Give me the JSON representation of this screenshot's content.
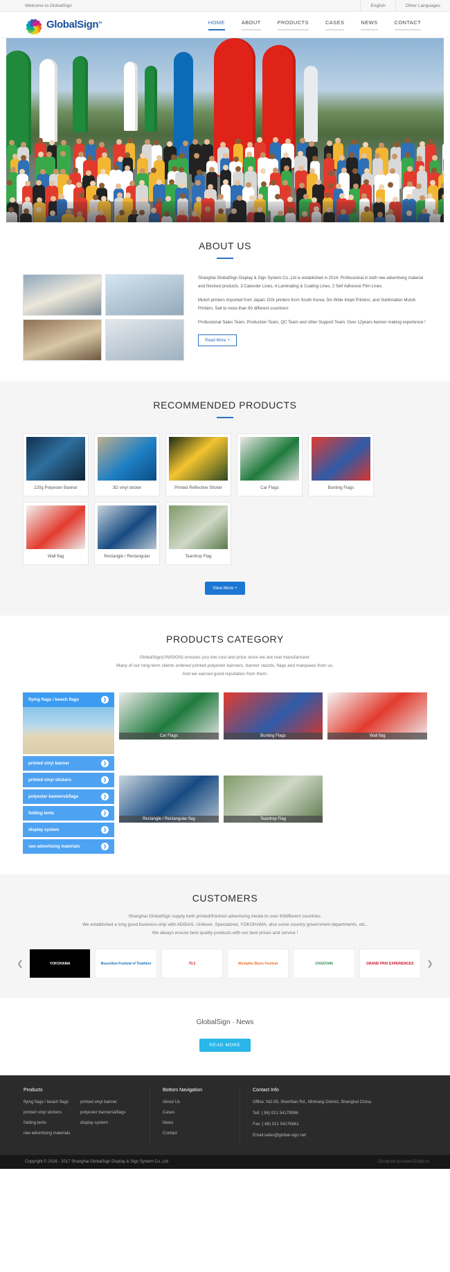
{
  "topbar": {
    "welcome": "Welcome to GlobalSign",
    "lang_primary": "English",
    "lang_other": "Other Languages"
  },
  "header": {
    "brand": "GlobalSign",
    "brand_tm": "тм",
    "nav": [
      {
        "label": "HOME",
        "active": true
      },
      {
        "label": "ABOUT",
        "active": false
      },
      {
        "label": "PRODUCTS",
        "active": false
      },
      {
        "label": "CASES",
        "active": false
      },
      {
        "label": "NEWS",
        "active": false
      },
      {
        "label": "CONTACT",
        "active": false
      }
    ]
  },
  "about": {
    "title": "ABOUT US",
    "paragraphs": [
      "Shanghai GlobalSign Display & Sign System Co.,Ltd is established in 2014. Professional in both raw advertising material and finished products. 3 Calender Lines, 4 Laminating & Coating Lines, 2 Self Adhesive Film Lines.",
      "Mutoh printers imported from Japan; DGI printers from South Korea; 5m Wide Inkjet Printers, and Sublimation Mutoh Printers. Sell to more than 60 different countries!",
      "Professional Sales Team, Production Team, QC Team and other Support Team. Over 12years banner making experience !"
    ],
    "read_more": "Read More +",
    "images": [
      "factory-banner-photo",
      "printer-workshop-photo",
      "company-gate-photo",
      "team-unisign-photo"
    ]
  },
  "recommended": {
    "title": "RECOMMENDED PRODUCTS",
    "items": [
      {
        "label": "220g Polyester Banner"
      },
      {
        "label": "3D vinyl sticker"
      },
      {
        "label": "Printed Reflective Sticker"
      },
      {
        "label": "Car Flags"
      },
      {
        "label": "Bunting Flags"
      },
      {
        "label": "Wall flag"
      },
      {
        "label": "Rectangle / Rectangular"
      },
      {
        "label": "Teardrop Flag"
      }
    ],
    "view_more": "View More +"
  },
  "category": {
    "title": "PRODUCTS CATEGORY",
    "subtitle_lines": [
      "GlobalSign(UNISIGN) ensures you low cost and price since we are real manufacturer.",
      "Many of our long-term clients ordered printed polyester banners, banner stands, flags and marquees from us.",
      "And we earned good reputation from them."
    ],
    "accordion_head": "flying flags / beach flags",
    "accordion_items": [
      "printed vinyl banner",
      "printed vinyl stickers",
      "polyester banners&flags",
      "folding tents",
      "display system",
      "raw advertising materials"
    ],
    "tiles": [
      {
        "caption": "Car Flags"
      },
      {
        "caption": "Bunting Flags"
      },
      {
        "caption": "Wall flag"
      },
      {
        "caption": "Rectangle / Rectangular flag"
      },
      {
        "caption": "Teardrop Flag"
      }
    ],
    "chevron": "❯"
  },
  "customers": {
    "title": "CUSTOMERS",
    "subtitle_lines": [
      "Shanghai GlobalSign supply both printed/finished advertising media to over 60different countries.",
      "We established a long good business-ship with ADIDAS, Unilever, Specialized, YOKOHAMA, also some country government departments, etc..",
      "We always ensure best quality products with our best prices and service !"
    ],
    "logos": [
      {
        "name": "YOKOHAMA"
      },
      {
        "name": "Busselton Festival of Triathlon"
      },
      {
        "name": "70.3"
      },
      {
        "name": "Memphis Blues Festival"
      },
      {
        "name": "CHASTAIN"
      },
      {
        "name": "GRAND PRIX EXPERIENCES"
      }
    ],
    "prev": "❮",
    "next": "❯"
  },
  "news": {
    "title": "GlobalSign · News",
    "read_more": "READ MORE"
  },
  "footer": {
    "products_title": "Products",
    "products_links": [
      "flying flags / beach flags",
      "printed vinyl banner",
      "printed vinyl stickers",
      "polyester banners&flags",
      "folding tents",
      "display system",
      "raw advertising materials"
    ],
    "nav_title": "Bottom Navigation",
    "nav_links": [
      "About Us",
      "Cases",
      "News",
      "Contact"
    ],
    "contact_title": "Contact Info",
    "contact_office": "Office: NO.59, ShenNan Rd., Minhang District, Shanghai China.",
    "contact_tel": "Tell: ( 86) 021 54179996",
    "contact_fax": "Fax: ( 86) 021 54176661",
    "contact_email": "Email:sales@global-sign.net",
    "copyright": "Copyright © 2016 - 2017 Shanghai GlobalSign Display & Sign System Co.,Ltd",
    "designed_by": "Designed by:www.021ttp.cn"
  },
  "colors": {
    "accent_blue": "#2b6fc4",
    "cat_blue": "#4ea2f2",
    "btn_blue": "#1b77d2",
    "cyan": "#29b6e8",
    "footer_bg": "#2b2b2b"
  }
}
